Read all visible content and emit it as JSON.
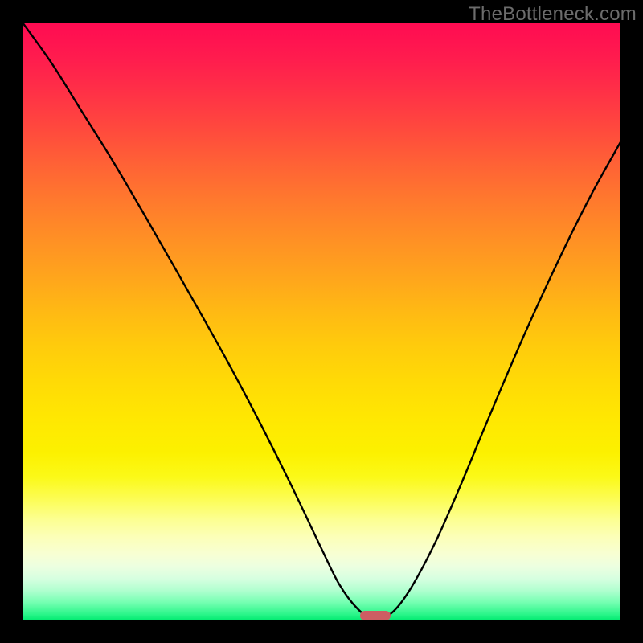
{
  "watermark": "TheBottleneck.com",
  "gradient": {
    "top": "#ff0b52",
    "mid": "#ffe702",
    "bottom": "#00ea70"
  },
  "marker": {
    "color": "#cd5d63",
    "x_pct": 59.0,
    "y_pct": 99.2
  },
  "chart_data": {
    "type": "line",
    "title": "",
    "xlabel": "",
    "ylabel": "",
    "xlim": [
      0,
      100
    ],
    "ylim": [
      0,
      100
    ],
    "grid": false,
    "annotations": [
      "TheBottleneck.com"
    ],
    "series": [
      {
        "name": "bottleneck-curve",
        "color": "#000000",
        "stroke_width": 2.4,
        "x": [
          0,
          5,
          10,
          15,
          20,
          25,
          30,
          35,
          40,
          45,
          50,
          53,
          56,
          59,
          62,
          65,
          69,
          73,
          78,
          84,
          90,
          95,
          100
        ],
        "y": [
          102,
          93,
          85,
          77,
          68.5,
          59.8,
          51,
          42,
          32.5,
          22.5,
          12,
          6,
          2,
          0,
          1.5,
          5.5,
          13,
          22,
          34,
          48,
          61,
          71,
          80
        ]
      }
    ],
    "ideal_zone": {
      "x_center_pct": 59.0,
      "width_pct": 5.1
    }
  }
}
